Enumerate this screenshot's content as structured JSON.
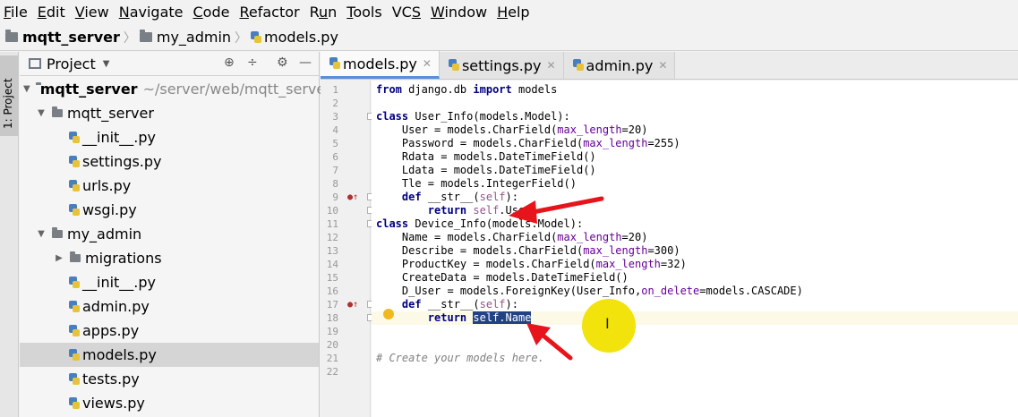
{
  "menu": {
    "items": [
      {
        "label": "File",
        "u": "F",
        "rest": "ile"
      },
      {
        "label": "Edit",
        "u": "E",
        "rest": "dit"
      },
      {
        "label": "View",
        "u": "V",
        "rest": "iew"
      },
      {
        "label": "Navigate",
        "u": "N",
        "rest": "avigate"
      },
      {
        "label": "Code",
        "u": "C",
        "rest": "ode"
      },
      {
        "label": "Refactor",
        "u": "R",
        "rest": "efactor"
      },
      {
        "label": "Run",
        "pre": "R",
        "u": "u",
        "rest": "n"
      },
      {
        "label": "Tools",
        "u": "T",
        "rest": "ools"
      },
      {
        "label": "VCS",
        "pre": "VC",
        "u": "S",
        "rest": ""
      },
      {
        "label": "Window",
        "u": "W",
        "rest": "indow"
      },
      {
        "label": "Help",
        "u": "H",
        "rest": "elp"
      }
    ]
  },
  "breadcrumb": [
    "mqtt_server",
    "my_admin",
    "models.py"
  ],
  "side_tab": {
    "label": "1: Project"
  },
  "project_panel": {
    "title": "Project",
    "tree": [
      {
        "label": "mqtt_server",
        "path": "~/server/web/mqtt_server",
        "type": "folder",
        "expanded": true,
        "bold": true
      },
      {
        "label": "mqtt_server",
        "type": "folder",
        "expanded": true
      },
      {
        "label": "__init__.py",
        "type": "py"
      },
      {
        "label": "settings.py",
        "type": "py"
      },
      {
        "label": "urls.py",
        "type": "py"
      },
      {
        "label": "wsgi.py",
        "type": "py"
      },
      {
        "label": "my_admin",
        "type": "folder",
        "expanded": true
      },
      {
        "label": "migrations",
        "type": "folder",
        "expanded": false
      },
      {
        "label": "__init__.py",
        "type": "py"
      },
      {
        "label": "admin.py",
        "type": "py"
      },
      {
        "label": "apps.py",
        "type": "py"
      },
      {
        "label": "models.py",
        "type": "py",
        "selected": true
      },
      {
        "label": "tests.py",
        "type": "py"
      },
      {
        "label": "views.py",
        "type": "py"
      }
    ]
  },
  "tabs": [
    {
      "label": "models.py",
      "active": true
    },
    {
      "label": "settings.py",
      "active": false
    },
    {
      "label": "admin.py",
      "active": false
    }
  ],
  "code_lines": [
    "from django.db import models",
    "",
    "class User_Info(models.Model):",
    "    User = models.CharField(max_length=20)",
    "    Password = models.CharField(max_length=255)",
    "    Rdata = models.DateTimeField()",
    "    Ldata = models.DateTimeField()",
    "    Tle = models.IntegerField()",
    "    def __str__(self):",
    "        return self.User",
    "class Device_Info(models.Model):",
    "    Name = models.CharField(max_length=20)",
    "    Describe = models.CharField(max_length=300)",
    "    ProductKey = models.CharField(max_length=32)",
    "    CreateData = models.DateTimeField()",
    "    D_User = models.ForeignKey(User_Info,on_delete=models.CASCADE)",
    "    def __str__(self):",
    "        return self.Name",
    "",
    "",
    "# Create your models here.",
    ""
  ],
  "selection": {
    "line": 18,
    "text": "self.Name"
  },
  "colors": {
    "keyword": "#000080",
    "self": "#94558d",
    "param": "#660099",
    "comment": "#808080",
    "selection": "#214283",
    "arrow": "#e8141c",
    "cursor_highlight": "#f2e200"
  }
}
